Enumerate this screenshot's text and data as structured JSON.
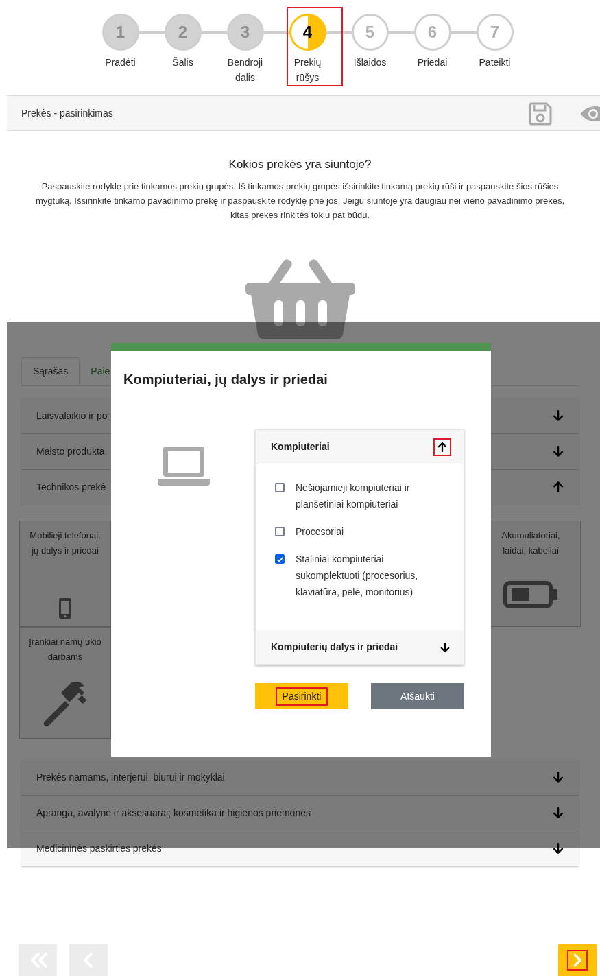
{
  "steps": [
    {
      "number": "1",
      "label": "Pradėti",
      "completed": true,
      "selected": false,
      "highlighted": false
    },
    {
      "number": "2",
      "label": "Šalis",
      "completed": true,
      "selected": false,
      "highlighted": false
    },
    {
      "number": "3",
      "label": "Bendroji dalis",
      "completed": true,
      "selected": false,
      "highlighted": false
    },
    {
      "number": "4",
      "label": "Prekių rūšys",
      "completed": false,
      "selected": true,
      "highlighted": true
    },
    {
      "number": "5",
      "label": "Išlaidos",
      "completed": false,
      "selected": false,
      "highlighted": false
    },
    {
      "number": "6",
      "label": "Priedai",
      "completed": false,
      "selected": false,
      "highlighted": false
    },
    {
      "number": "7",
      "label": "Pateikti",
      "completed": false,
      "selected": false,
      "highlighted": false
    }
  ],
  "toolbar": {
    "title": "Prekės - pasirinkimas"
  },
  "question": {
    "title": "Kokios prekės yra siuntoje?",
    "instructions": "Paspauskite rodyklę prie tinkamos prekių grupės. Iš tinkamos prekių grupės išsirinkite tinkamą prekių rūšį ir paspauskite šios rūšies mygtuką. Išsirinkite tinkamo pavadinimo prekę ir paspauskite rodyklę prie jos. Jeigu siuntoje yra daugiau nei vieno pavadinimo prekės, kitas prekes rinkitės tokiu pat būdu."
  },
  "tabs": [
    {
      "label": "Sąrašas",
      "selected": true
    },
    {
      "label": "Paie",
      "selected": false
    }
  ],
  "categories": [
    {
      "label": "Laisvalaikio ir po",
      "expanded": false
    },
    {
      "label": "Maisto produkta",
      "expanded": false
    },
    {
      "label": "Technikos prekė",
      "expanded": true,
      "cards": [
        {
          "label": "Mobilieji telefonai, jų dalys ir priedai",
          "kind": "phone"
        },
        {
          "label": "Akumuliatoriai, laidai, kabeliai",
          "kind": "battery"
        },
        {
          "label": "Įrankiai namų ūkio darbams",
          "kind": "hammer"
        }
      ]
    },
    {
      "label": "Prekės namams, interjerui, biurui ir mokyklai",
      "expanded": false
    },
    {
      "label": "Apranga, avalynė ir aksesuarai; kosmetika ir higienos priemonės",
      "expanded": false
    },
    {
      "label": "Medicininės paskirties prekės",
      "expanded": false
    }
  ],
  "modal": {
    "title": "Kompiuteriai, jų dalys ir priedai",
    "groups": [
      {
        "title": "Kompiuteriai",
        "expanded": true,
        "highlighted": true,
        "items": [
          {
            "label": "Nešiojamieji kompiuteriai ir planšetiniai kompiuteriai",
            "checked": false
          },
          {
            "label": "Procesoriai",
            "checked": false
          },
          {
            "label": "Staliniai kompiuteriai sukomplektuoti (procesorius, klaviatūra, pelė, monitorius)",
            "checked": true
          }
        ]
      },
      {
        "title": "Kompiuterių dalys ir priedai",
        "expanded": false,
        "highlighted": false
      }
    ],
    "buttons": [
      {
        "label": "Pasirinkti",
        "kind": "primary",
        "highlighted": true
      },
      {
        "label": "Atšaukti",
        "kind": "secondary",
        "highlighted": false
      }
    ]
  },
  "nav": [
    {
      "kind": "first",
      "disabled": true,
      "highlighted": false
    },
    {
      "kind": "prev",
      "disabled": true,
      "highlighted": false
    },
    {
      "kind": "next",
      "disabled": false,
      "highlighted": true
    }
  ]
}
